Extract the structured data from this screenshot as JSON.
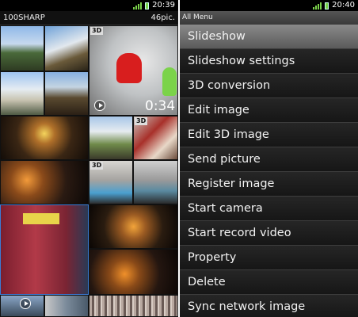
{
  "left_screen": {
    "status_time": "20:39",
    "album_name": "100SHARP",
    "pic_count": "46pic.",
    "badge_3d": "3D",
    "video_duration": "0:34"
  },
  "right_screen": {
    "status_time": "20:40",
    "menu_title": "All Menu",
    "menu_items": [
      "Slideshow",
      "Slideshow settings",
      "3D conversion",
      "Edit image",
      "Edit 3D image",
      "Send picture",
      "Register image",
      "Start camera",
      "Start record video",
      "Property",
      "Delete",
      "Sync network image"
    ]
  },
  "colors": {
    "signal": "#7bd34a",
    "menu_highlight": "#7a7a7a",
    "divider": "#ffffff"
  },
  "icons": [
    "signal-icon",
    "battery-icon",
    "play-icon"
  ]
}
